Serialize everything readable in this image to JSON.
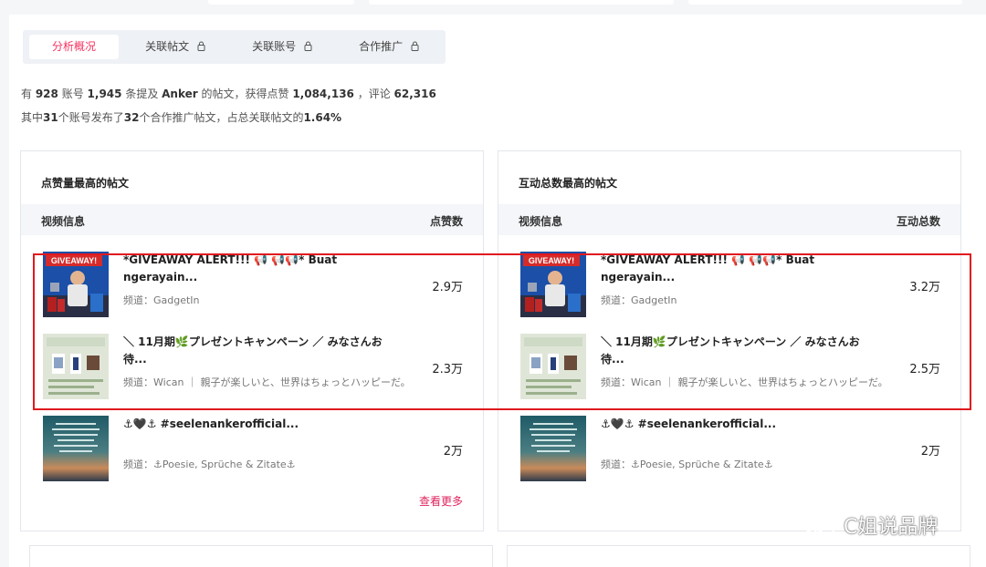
{
  "tabs": [
    {
      "label": "分析概况"
    },
    {
      "label": "关联帖文"
    },
    {
      "label": "关联账号"
    },
    {
      "label": "合作推广"
    }
  ],
  "summary": {
    "line1": {
      "p1": "有 ",
      "accounts": "928",
      "p2": " 账号 ",
      "posts": "1,945",
      "p3": " 条提及 ",
      "brand": "Anker",
      "p4": " 的帖文，获得点赞 ",
      "likes": "1,084,136",
      "p5": " ，评论 ",
      "comments": "62,316"
    },
    "line2": {
      "p1": "其中",
      "accounts": "31",
      "p2": "个账号发布了",
      "posts": "32",
      "p3": "个合作推广帖文，占总关联帖文的",
      "percent": "1.64%"
    }
  },
  "panels": {
    "likes": {
      "title": "点赞量最高的帖文",
      "col_info": "视频信息",
      "col_metric": "点赞数",
      "more": "查看更多",
      "rows": [
        {
          "title": "*GIVEAWAY ALERT!!! 📢 📢📢* Buat ngerayain...",
          "channel": "频道：GadgetIn",
          "value": "2.9万"
        },
        {
          "title": "＼ 11月期🌿プレゼントキャンペーン ／ みなさんお待...",
          "channel": "频道：Wican ｜ 親子が楽しいと、世界はちょっとハッピーだ。",
          "value": "2.3万"
        },
        {
          "title": "⚓🖤⚓ #seelenankerofficial...",
          "channel": "频道：⚓Poesie, Sprüche & Zitate⚓",
          "value": "2万"
        }
      ]
    },
    "interactions": {
      "title": "互动总数最高的帖文",
      "col_info": "视频信息",
      "col_metric": "互动总数",
      "rows": [
        {
          "title": "*GIVEAWAY ALERT!!! 📢 📢📢* Buat ngerayain...",
          "channel": "频道：GadgetIn",
          "value": "3.2万"
        },
        {
          "title": "＼ 11月期🌿プレゼントキャンペーン ／ みなさんお待...",
          "channel": "频道：Wican ｜ 親子が楽しいと、世界はちょっとハッピーだ。",
          "value": "2.5万"
        },
        {
          "title": "⚓🖤⚓ #seelenankerofficial...",
          "channel": "频道：⚓Poesie, Sprüche & Zitate⚓",
          "value": "2万"
        }
      ]
    }
  },
  "thumbnails": {
    "giveaway_label": "GIVEAWAY!"
  },
  "watermark": "C姐说品牌",
  "colors": {
    "accent": "#f5315f",
    "more_link": "#e0245e",
    "highlight": "#e0191e"
  }
}
